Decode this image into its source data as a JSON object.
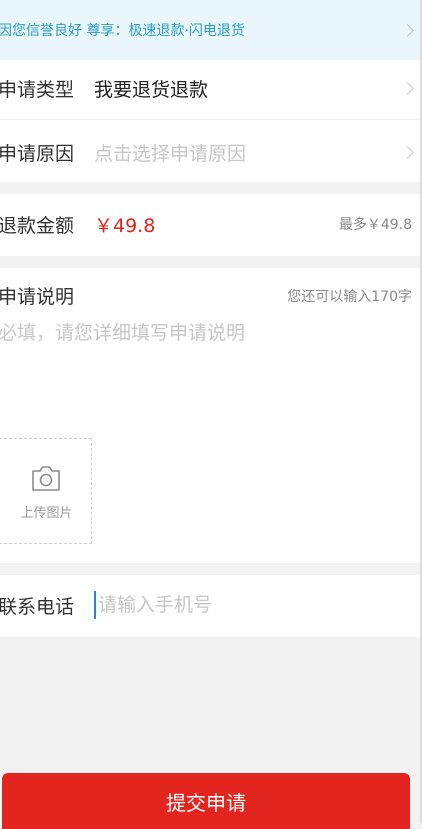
{
  "banner": {
    "text": "因您信誉良好 尊享：极速退款·闪电退货"
  },
  "apply_type": {
    "label": "申请类型",
    "value": "我要退货退款"
  },
  "apply_reason": {
    "label": "申请原因",
    "placeholder": "点击选择申请原因"
  },
  "refund": {
    "label": "退款金额",
    "amount": "￥49.8",
    "max": "最多￥49.8"
  },
  "description": {
    "label": "申请说明",
    "counter": "您还可以输入170字",
    "placeholder": "必填，请您详细填写申请说明",
    "value": ""
  },
  "upload": {
    "label": "上传图片",
    "icon": "camera-icon"
  },
  "phone": {
    "label": "联系电话",
    "placeholder": "请输入手机号",
    "value": ""
  },
  "submit": {
    "label": "提交申请"
  },
  "colors": {
    "accent": "#e2261f",
    "price": "#e0241d",
    "banner_text": "#2d9fc7",
    "banner_bg": "#e9f6fb"
  }
}
